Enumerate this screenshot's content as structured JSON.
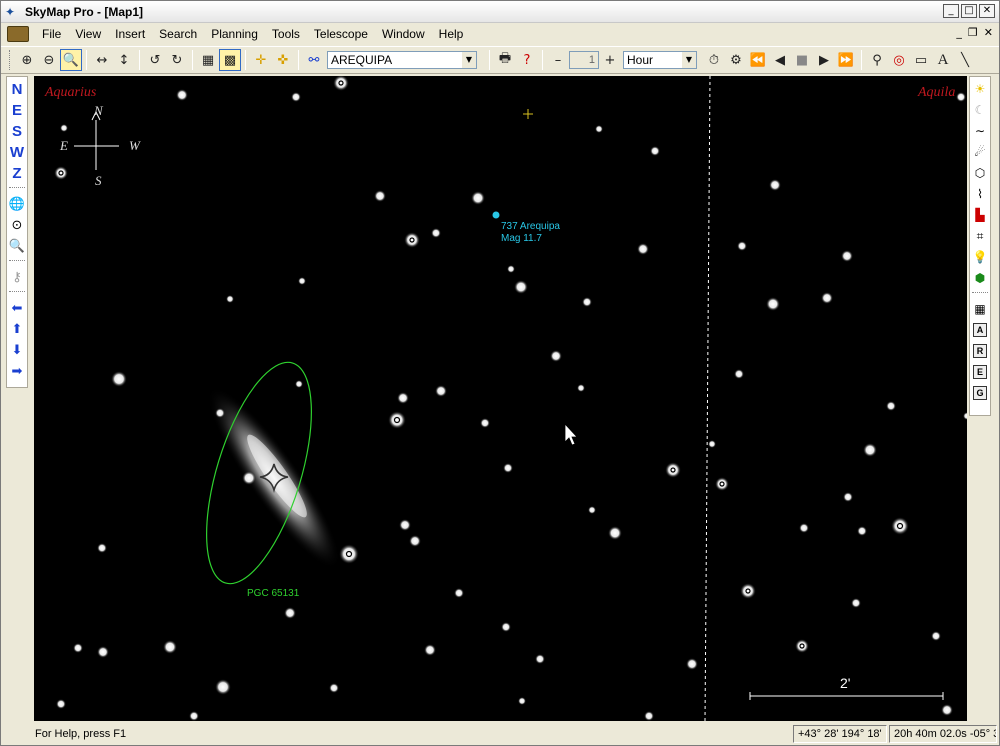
{
  "window": {
    "title": "SkyMap Pro - [Map1]"
  },
  "menu": {
    "items": [
      "File",
      "View",
      "Insert",
      "Search",
      "Planning",
      "Tools",
      "Telescope",
      "Window",
      "Help"
    ]
  },
  "toolbar": {
    "search_value": "AREQUIPA",
    "step_value": "1",
    "time_unit": "Hour",
    "minus_label": "–",
    "plus_label": "+"
  },
  "left_toolbar": {
    "directions": [
      "N",
      "E",
      "S",
      "W",
      "Z"
    ]
  },
  "right_toolbar": {
    "letters": [
      "A",
      "R",
      "E",
      "G"
    ]
  },
  "map": {
    "constellation_left": "Aquarius",
    "constellation_right": "Aquila",
    "compass": {
      "north": "N",
      "south": "S",
      "east": "E",
      "west": "W"
    },
    "asteroid_name": "737 Arequipa",
    "asteroid_mag": "Mag 11.7",
    "galaxy_label": "PGC 65131",
    "scale_label": "2'",
    "colors": {
      "constellation": "#c0181f",
      "asteroid": "#29c7e6",
      "galaxy": "#2fd12f",
      "background": "#000000"
    }
  },
  "status": {
    "help": "For Help, press F1",
    "altaz": "+43° 28'  194° 18'",
    "radec": "20h 40m 02.0s  -05° 3"
  }
}
